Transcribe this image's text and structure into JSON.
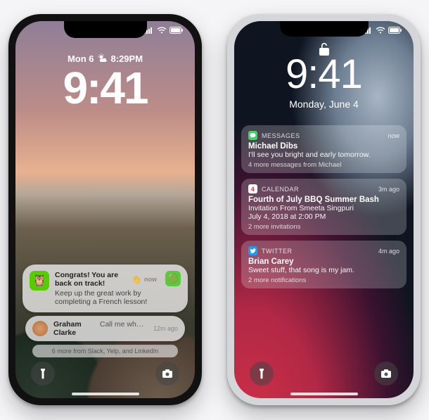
{
  "left": {
    "date": "Mon 6",
    "timeIndicator": "8:29PM",
    "time": "9:41",
    "notif1": {
      "app": "Duolingo",
      "title": "Congrats! You are back on track!",
      "titleEmoji": "👋",
      "body": "Keep up the great work by completing a French lesson!",
      "when": "now"
    },
    "notif2": {
      "sender": "Graham Clarke",
      "preview": "Call me when y…",
      "when": "12m ago"
    },
    "more": "6 more from Slack, Yelp, and LinkedIn"
  },
  "right": {
    "time": "9:41",
    "date": "Monday, June 4",
    "cards": [
      {
        "app": "MESSAGES",
        "when": "now",
        "title": "Michael Dibs",
        "body": "I'll see you bright and early tomorrow.",
        "more": "4 more messages from Michael",
        "calDay": ""
      },
      {
        "app": "CALENDAR",
        "when": "3m ago",
        "title": "Fourth of July BBQ Summer Bash",
        "body": "Invitation From Smeeta Singpuri",
        "body2": "July 4, 2018 at 2:00 PM",
        "more": "2 more invitations",
        "calDay": "4"
      },
      {
        "app": "TWITTER",
        "when": "4m ago",
        "title": "Brian Carey",
        "body": "Sweet stuff, that song is my jam.",
        "more": "2 more notifications",
        "calDay": ""
      }
    ]
  }
}
